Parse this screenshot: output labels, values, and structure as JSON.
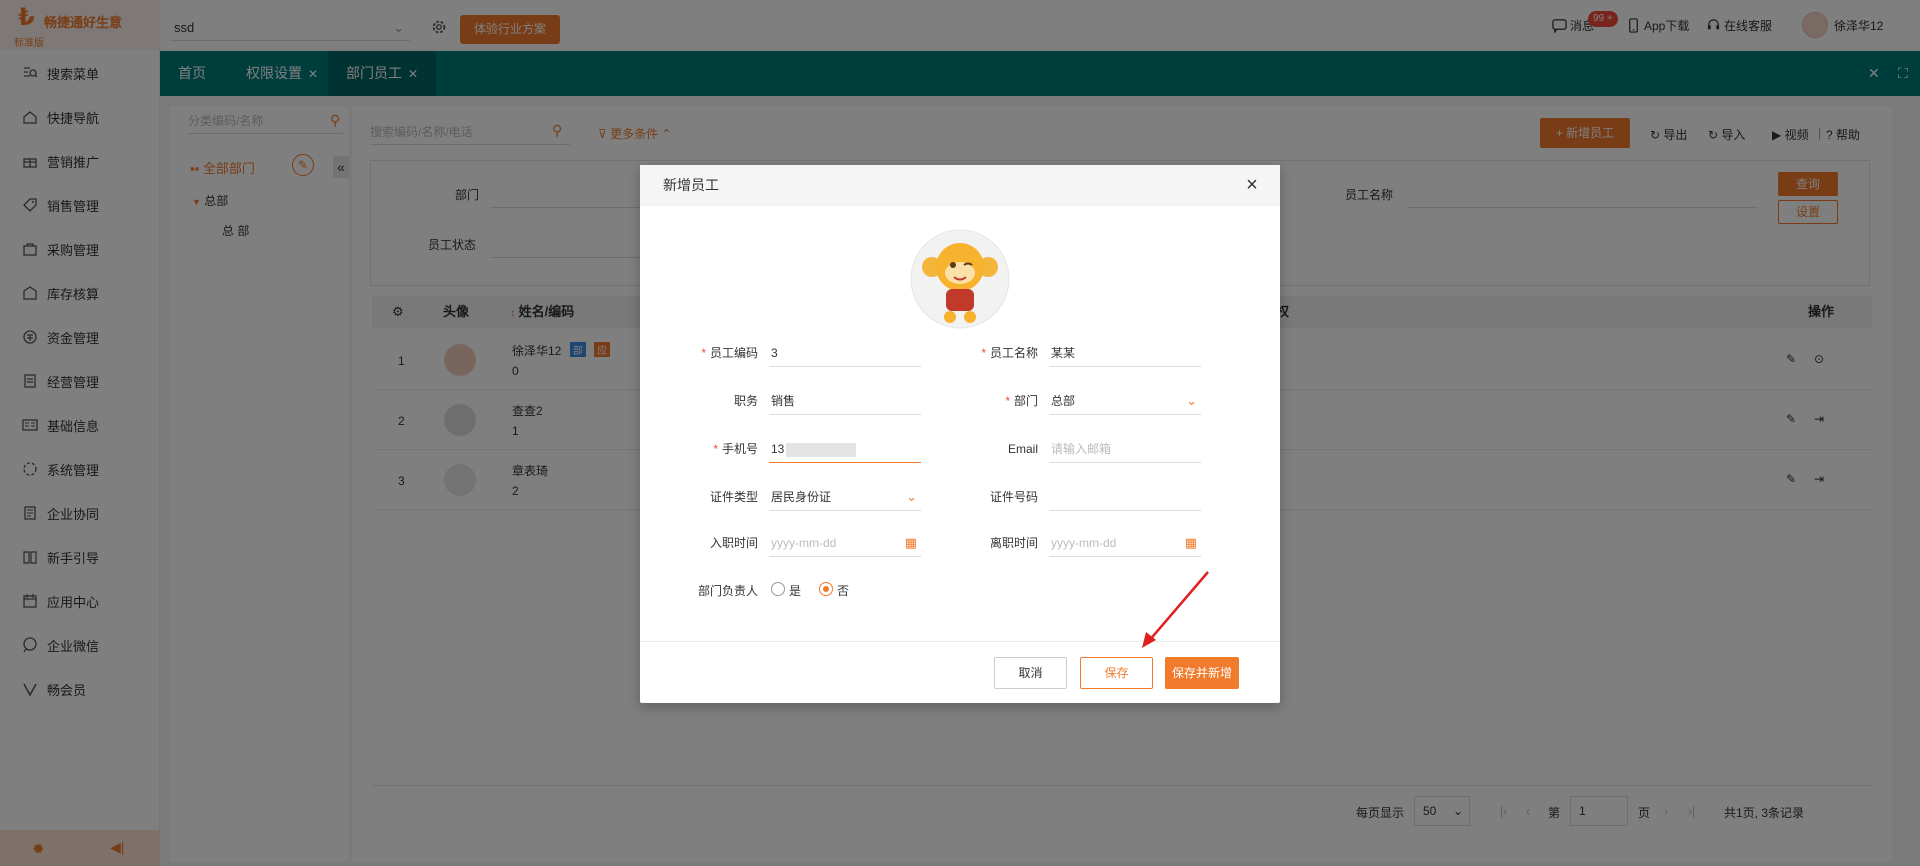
{
  "brand": {
    "name": "畅捷通好生意",
    "edition": "标准版",
    "accent": "#f07b2c",
    "teal": "#007d7a"
  },
  "topbar": {
    "account_select": "ssd",
    "plan_button": "体验行业方案",
    "message_badge": "99 +",
    "message_label": "消息",
    "app_label": "App下载",
    "service_label": "在线客服",
    "user_name": "徐泽华12"
  },
  "sidebar": {
    "items": [
      {
        "label": "搜索菜单",
        "icon": "search-menu-icon"
      },
      {
        "label": "快捷导航",
        "icon": "home-icon"
      },
      {
        "label": "营销推广",
        "icon": "gift-icon"
      },
      {
        "label": "销售管理",
        "icon": "tag-icon"
      },
      {
        "label": "采购管理",
        "icon": "bag-icon"
      },
      {
        "label": "库存核算",
        "icon": "warehouse-icon"
      },
      {
        "label": "资金管理",
        "icon": "money-icon"
      },
      {
        "label": "经营管理",
        "icon": "clipboard-icon"
      },
      {
        "label": "基础信息",
        "icon": "card-icon"
      },
      {
        "label": "系统管理",
        "icon": "settings-ring-icon"
      },
      {
        "label": "企业协同",
        "icon": "doc-icon"
      },
      {
        "label": "新手引导",
        "icon": "book-icon"
      },
      {
        "label": "应用中心",
        "icon": "calendar-icon"
      },
      {
        "label": "企业微信",
        "icon": "chat-icon"
      },
      {
        "label": "畅会员",
        "icon": "v-icon"
      }
    ]
  },
  "tabs": [
    {
      "label": "首页"
    },
    {
      "label": "权限设置"
    },
    {
      "label": "部门员工"
    }
  ],
  "tree": {
    "search_placeholder": "分类编码/名称",
    "root": "全部部门",
    "node": "总部",
    "child": "总 部"
  },
  "main": {
    "search_placeholder": "搜索编码/名称/电话",
    "more_filters": "更多条件",
    "add_employee": "+ 新增员工",
    "export": "导出",
    "import": "导入",
    "video": "视频",
    "help": "帮助",
    "filter_dept": "部门",
    "filter_status": "员工状态",
    "filter_name": "员工名称",
    "query": "查询",
    "settings": "设置",
    "col_avatar": "头像",
    "col_name": "姓名/编码",
    "col_ops": "操作",
    "col_right_fragment": "权",
    "rows": [
      {
        "idx": "1",
        "name": "徐泽华12",
        "code": "0",
        "tag1": "部",
        "tag2": "应"
      },
      {
        "idx": "2",
        "name": "查查2",
        "code": "1"
      },
      {
        "idx": "3",
        "name": "章表琦",
        "code": "2"
      }
    ],
    "pager": {
      "per_page_label": "每页显示",
      "per_page": "50",
      "page_prefix": "第",
      "page": "1",
      "page_suffix": "页",
      "summary": "共1页, 3条记录"
    }
  },
  "modal": {
    "title": "新增员工",
    "close": "×",
    "fields": {
      "code_label": "员工编码",
      "code_value": "3",
      "name_label": "员工名称",
      "name_value": "某某",
      "position_label": "职务",
      "position_value": "销售",
      "dept_label": "部门",
      "dept_value": "总部",
      "phone_label": "手机号",
      "phone_value": "13",
      "email_label": "Email",
      "email_placeholder": "请输入邮箱",
      "idtype_label": "证件类型",
      "idtype_value": "居民身份证",
      "idno_label": "证件号码",
      "join_label": "入职时间",
      "join_placeholder": "yyyy-mm-dd",
      "leave_label": "离职时间",
      "leave_placeholder": "yyyy-mm-dd",
      "head_label": "部门负责人",
      "yes": "是",
      "no": "否"
    },
    "buttons": {
      "cancel": "取消",
      "save": "保存",
      "save_new": "保存并新增"
    }
  }
}
